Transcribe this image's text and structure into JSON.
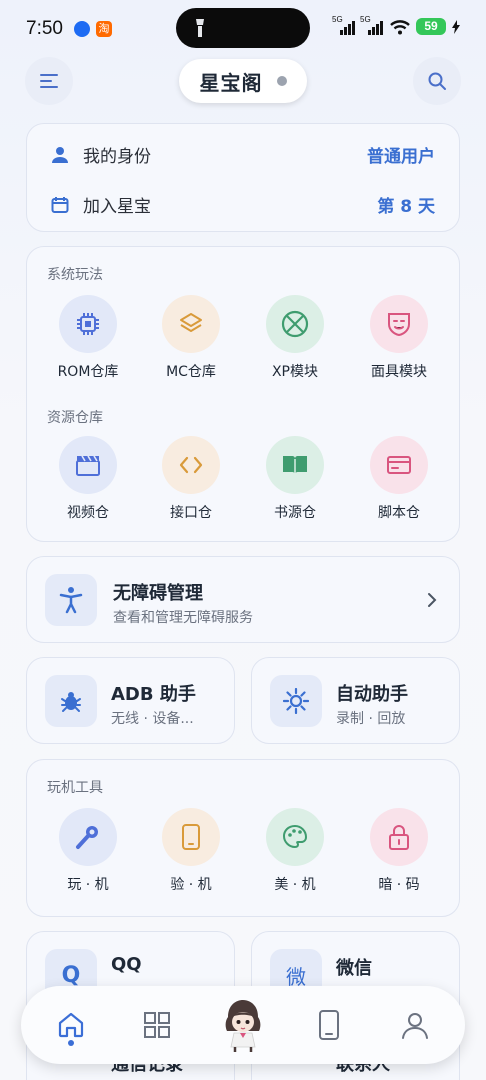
{
  "status": {
    "time": "7:50",
    "app2": "淘",
    "sim1": "5G",
    "sim2": "5G",
    "battery": "59"
  },
  "header": {
    "title": "星宝阁"
  },
  "identity": {
    "role_label": "我的身份",
    "role_value": "普通用户",
    "days_label": "加入星宝",
    "days_value": "第 8 天"
  },
  "system": {
    "title": "系统玩法",
    "items": [
      {
        "label": "ROM仓库",
        "icon": "chip-icon",
        "color": "#4f6fd8",
        "bg": "#e2e8f8"
      },
      {
        "label": "MC仓库",
        "icon": "layers-icon",
        "color": "#d99a3a",
        "bg": "#f8ece0"
      },
      {
        "label": "XP模块",
        "icon": "x-circle-icon",
        "color": "#3f9c6f",
        "bg": "#dcefe6"
      },
      {
        "label": "面具模块",
        "icon": "mask-icon",
        "color": "#d9557f",
        "bg": "#f9e2ea"
      }
    ]
  },
  "resources": {
    "title": "资源仓库",
    "items": [
      {
        "label": "视频仓",
        "icon": "clapper-icon",
        "color": "#4f6fd8",
        "bg": "#e2e8f8"
      },
      {
        "label": "接口仓",
        "icon": "code-icon",
        "color": "#d99a3a",
        "bg": "#f8ece0"
      },
      {
        "label": "书源仓",
        "icon": "book-icon",
        "color": "#3f9c6f",
        "bg": "#dcefe6"
      },
      {
        "label": "脚本仓",
        "icon": "script-icon",
        "color": "#d9557f",
        "bg": "#f9e2ea"
      }
    ]
  },
  "accessibility": {
    "title": "无障碍管理",
    "subtitle": "查看和管理无障碍服务"
  },
  "adb": {
    "title": "ADB 助手",
    "subtitle": "无线 · 设备..."
  },
  "auto": {
    "title": "自动助手",
    "subtitle": "录制 · 回放"
  },
  "tools": {
    "title": "玩机工具",
    "items": [
      {
        "label": "玩 · 机",
        "icon": "wrench-icon",
        "color": "#4f6fd8",
        "bg": "#e2e8f8"
      },
      {
        "label": "验 · 机",
        "icon": "phone-check-icon",
        "color": "#d99a3a",
        "bg": "#f8ece0"
      },
      {
        "label": "美 · 机",
        "icon": "palette-icon",
        "color": "#3f9c6f",
        "bg": "#dcefe6"
      },
      {
        "label": "暗 · 码",
        "icon": "lock-icon",
        "color": "#d9557f",
        "bg": "#f9e2ea"
      }
    ]
  },
  "social": {
    "qq": "QQ",
    "qq_glyph": "Q",
    "wechat": "微信",
    "wechat_glyph": "微",
    "contacts_log": "通信记录",
    "contacts": "联系人"
  }
}
